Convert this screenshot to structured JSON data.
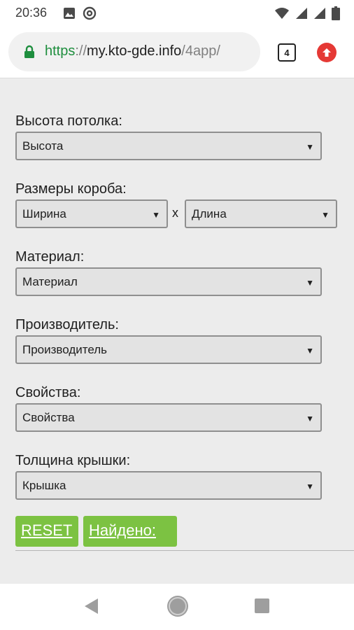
{
  "status_bar": {
    "time": "20:36",
    "left_icons": [
      "image-icon",
      "at-sign-icon"
    ],
    "right_icons": [
      "wifi-icon",
      "signal-icon",
      "signal-icon",
      "battery-icon"
    ]
  },
  "browser": {
    "url_scheme": "https",
    "url_sep": "://",
    "url_host": "my.kto-gde.info",
    "url_path": "/4app/",
    "tab_count": "4",
    "colors": {
      "secure": "#1e8e3e",
      "update": "#e53935"
    }
  },
  "form": {
    "ceiling_label": "Высота потолка:",
    "ceiling_value": "Высота",
    "box_label": "Размеры короба:",
    "width_value": "Ширина",
    "x_sep": "x",
    "length_value": "Длина",
    "material_label": "Материал:",
    "material_value": "Материал",
    "manufacturer_label": "Производитель:",
    "manufacturer_value": "Производитель",
    "properties_label": "Свойства:",
    "properties_value": "Свойства",
    "lid_label": "Толщина крышки:",
    "lid_value": "Крышка",
    "arrow": "▼"
  },
  "actions": {
    "reset_label": "RESET",
    "found_label": "Найдено: ",
    "color": "#7cc242"
  },
  "nav_bar": {
    "icons": [
      "back-icon",
      "home-icon",
      "recent-apps-icon"
    ]
  }
}
